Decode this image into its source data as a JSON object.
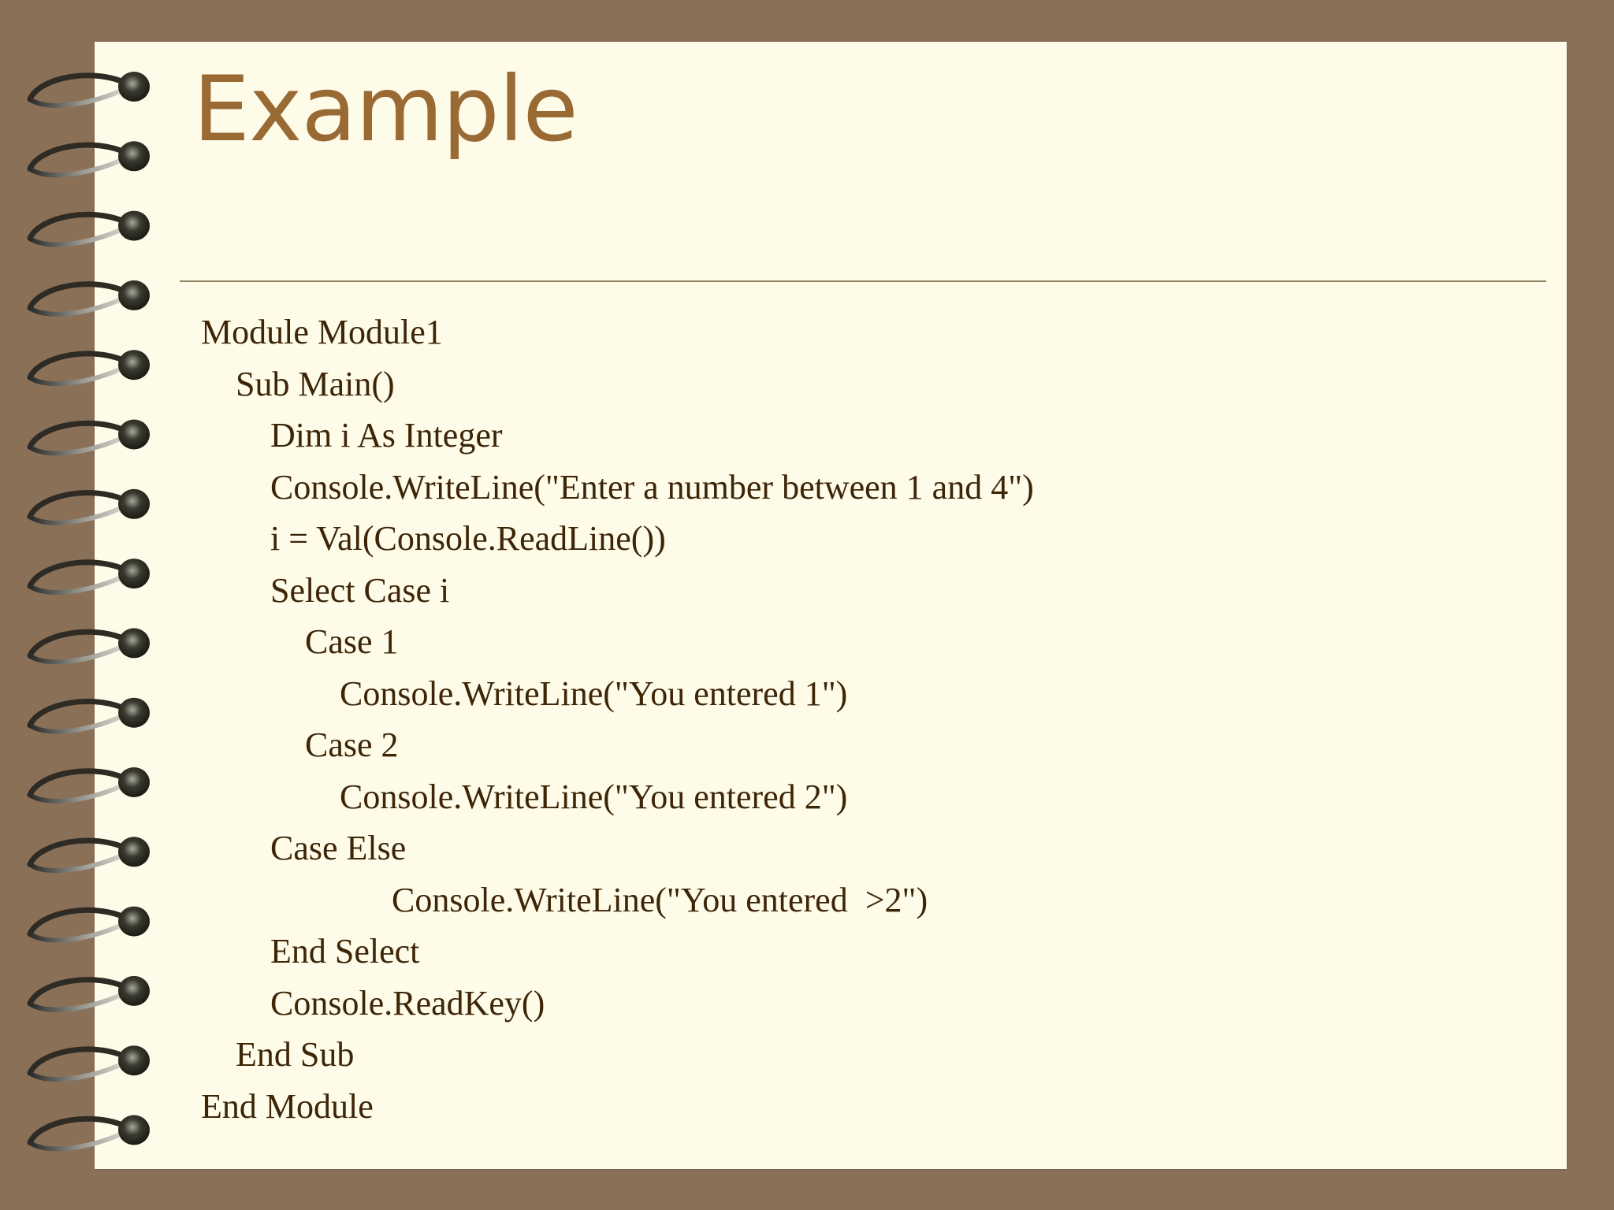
{
  "slide": {
    "title": "Example"
  },
  "code_lines": [
    "Module Module1",
    "    Sub Main()",
    "        Dim i As Integer",
    "        Console.WriteLine(\"Enter a number between 1 and 4\")",
    "        i = Val(Console.ReadLine())",
    "        Select Case i",
    "            Case 1",
    "                Console.WriteLine(\"You entered 1\")",
    "            Case 2",
    "                Console.WriteLine(\"You entered 2\")",
    "        Case Else",
    "                      Console.WriteLine(\"You entered  >2\")",
    "        End Select",
    "        Console.ReadKey()",
    "    End Sub",
    "End Module"
  ],
  "colors": {
    "background": "#8b7058",
    "paper": "#fefbe9",
    "title": "#9a6a35",
    "text": "#3d2508",
    "rule": "#8f8562"
  }
}
